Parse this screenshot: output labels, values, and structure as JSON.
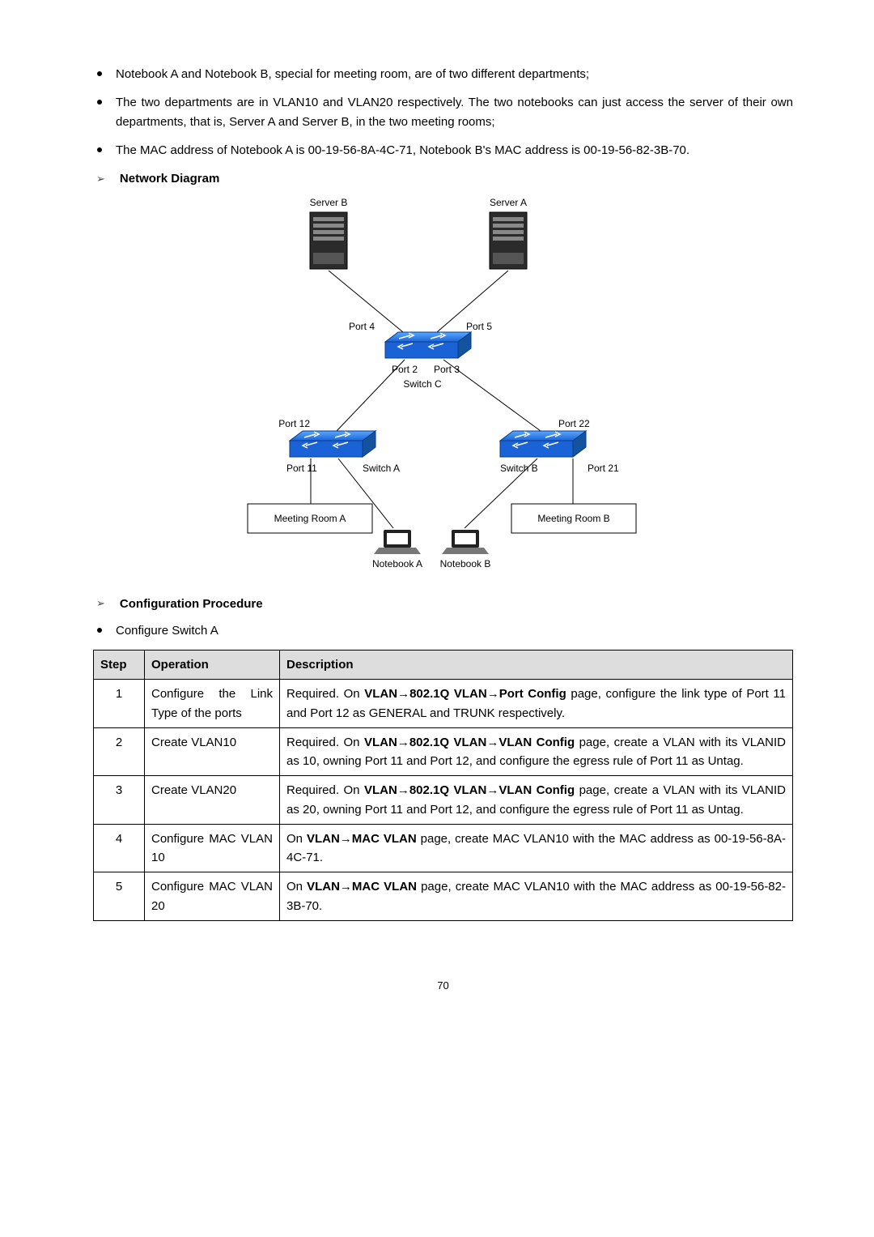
{
  "bullets": [
    "Notebook A and Notebook B, special for meeting room, are of two different departments;",
    "The two departments are in VLAN10 and VLAN20 respectively. The two notebooks can just access the server of their own departments, that is, Server A and Server B, in the two meeting rooms;",
    "The MAC address of Notebook A is 00-19-56-8A-4C-71, Notebook B's MAC address is 00-19-56-82-3B-70."
  ],
  "sections": {
    "network_diagram": "Network Diagram",
    "config_procedure": "Configuration Procedure",
    "configure_switch_a": "Configure Switch A"
  },
  "diagram": {
    "server_b": "Server B",
    "server_a": "Server A",
    "port4": "Port 4",
    "port5": "Port 5",
    "port2": "Port 2",
    "port3": "Port 3",
    "switch_c": "Switch C",
    "port12": "Port 12",
    "port22": "Port 22",
    "port11": "Port 11",
    "port21": "Port 21",
    "switch_a": "Switch A",
    "switch_b": "Switch B",
    "meeting_a": "Meeting Room A",
    "meeting_b": "Meeting Room B",
    "notebook_a": "Notebook A",
    "notebook_b": "Notebook B"
  },
  "table": {
    "headers": {
      "step": "Step",
      "operation": "Operation",
      "description": "Description"
    },
    "rows": [
      {
        "step": "1",
        "op": "Configure the Link Type of the ports",
        "desc_pre": "Required. On ",
        "desc_bold": "VLAN→802.1Q VLAN→Port Config",
        "desc_post": " page, configure the link type of Port 11 and Port 12 as GENERAL and TRUNK respectively."
      },
      {
        "step": "2",
        "op": "Create VLAN10",
        "desc_pre": "Required. On ",
        "desc_bold": "VLAN→802.1Q VLAN→VLAN Config",
        "desc_post": " page, create a VLAN with its VLANID as 10, owning Port 11 and Port 12, and configure the egress rule of Port 11 as Untag."
      },
      {
        "step": "3",
        "op": "Create VLAN20",
        "desc_pre": "Required. On ",
        "desc_bold": "VLAN→802.1Q VLAN→VLAN Config",
        "desc_post": " page, create a VLAN with its VLANID as 20, owning Port 11 and Port 12, and configure the egress rule of Port 11 as Untag."
      },
      {
        "step": "4",
        "op": "Configure MAC VLAN 10",
        "desc_pre": "On ",
        "desc_bold": "VLAN→MAC VLAN",
        "desc_post": " page, create MAC VLAN10 with the MAC address as 00-19-56-8A-4C-71."
      },
      {
        "step": "5",
        "op": "Configure MAC VLAN 20",
        "desc_pre": "On ",
        "desc_bold": "VLAN→MAC VLAN",
        "desc_post": " page, create MAC VLAN10 with the MAC address as 00-19-56-82-3B-70."
      }
    ]
  },
  "page_number": "70"
}
